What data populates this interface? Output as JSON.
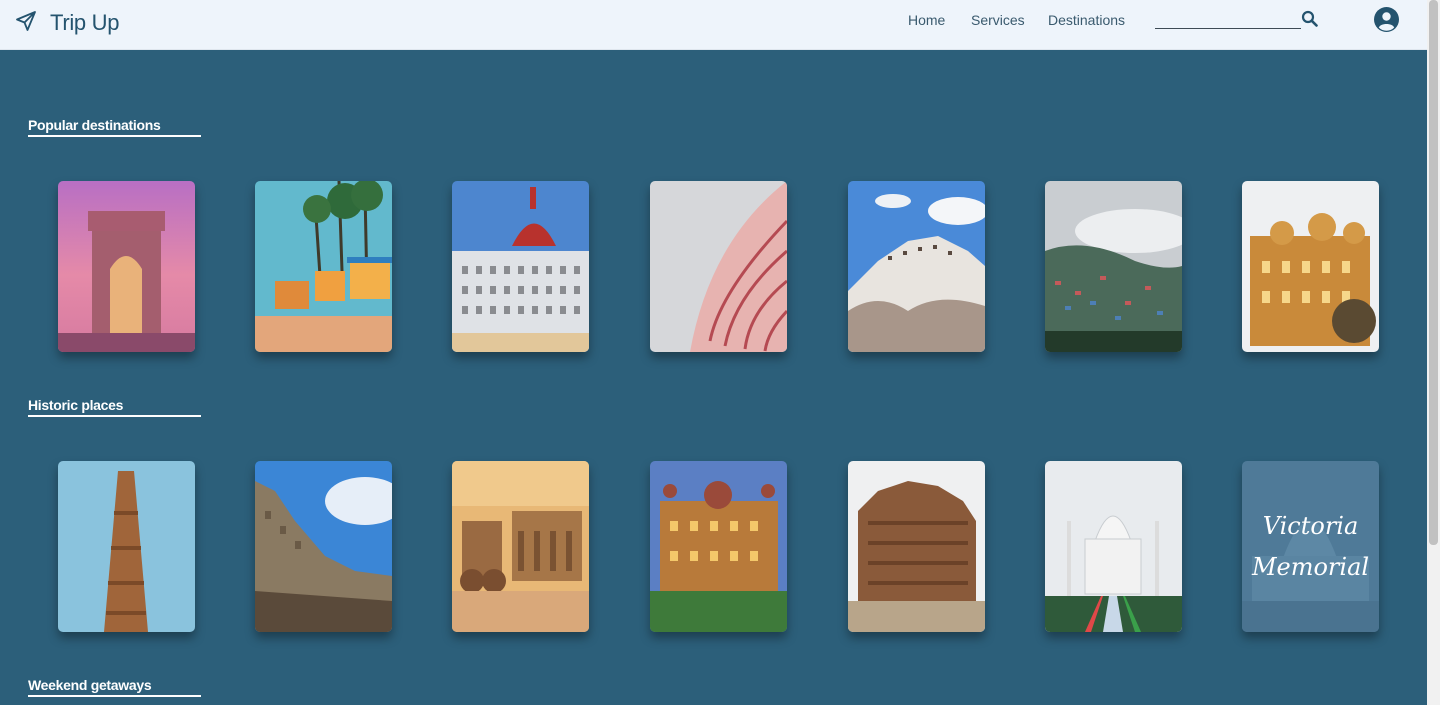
{
  "header": {
    "brand": "Trip Up",
    "nav": [
      {
        "label": "Home"
      },
      {
        "label": "Services"
      },
      {
        "label": "Destinations"
      }
    ],
    "search_placeholder": ""
  },
  "sections": [
    {
      "title": "Popular destinations",
      "places": [
        "india-gate",
        "goa-beach-huts",
        "taj-hotel-mumbai",
        "hawa-mahal",
        "thiksey-monastery",
        "hill-town",
        "palace-udaipur"
      ]
    },
    {
      "title": "Historic places",
      "places": [
        "qutub-minar",
        "gwalior-fort",
        "hampi-stone-chariot",
        "mysore-palace",
        "ancient-temple",
        "taj-mahal",
        "victoria-memorial"
      ]
    },
    {
      "title": "Weekend getaways",
      "places": []
    }
  ],
  "overlay_text": {
    "victoria_line1": "Victoria",
    "victoria_line2": "Memorial"
  },
  "colors": {
    "background": "#2c5f7a",
    "navbar": "#eef4fb",
    "brand": "#24536e"
  }
}
